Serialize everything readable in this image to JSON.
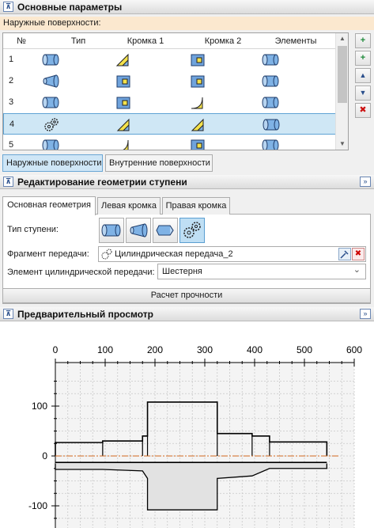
{
  "main_section": {
    "title": "Основные параметры",
    "collapse_glyph": "⊼",
    "subheader": "Наружные поверхности:"
  },
  "grid": {
    "columns": [
      "№",
      "Тип",
      "Кромка 1",
      "Кромка 2",
      "Элементы"
    ],
    "rows": [
      {
        "num": "1",
        "type": "cylinder-icon",
        "edge1": "chamfer-icon",
        "edge2": "groove-icon",
        "elements": "cylinder-icon"
      },
      {
        "num": "2",
        "type": "cone-icon",
        "edge1": "groove-icon",
        "edge2": "groove-icon",
        "elements": "cylinder-icon"
      },
      {
        "num": "3",
        "type": "cylinder-icon",
        "edge1": "groove-icon",
        "edge2": "fillet-icon",
        "elements": "cylinder-icon"
      },
      {
        "num": "4",
        "type": "gear-icon",
        "edge1": "chamfer-icon",
        "edge2": "chamfer-icon",
        "elements": "cylinder-icon",
        "selected": true
      },
      {
        "num": "5",
        "type": "cylinder-icon",
        "edge1": "fillet-icon",
        "edge2": "groove-icon",
        "elements": "cylinder-icon"
      }
    ]
  },
  "side_buttons": [
    {
      "name": "add-surface-button",
      "icon": "add-icon",
      "glyph": "+"
    },
    {
      "name": "insert-surface-button",
      "icon": "insert-icon",
      "glyph": "+"
    },
    {
      "name": "move-up-button",
      "icon": "chevron-up-icon",
      "glyph": "▲"
    },
    {
      "name": "move-down-button",
      "icon": "chevron-down-icon",
      "glyph": "▼"
    },
    {
      "name": "delete-button",
      "icon": "delete-icon",
      "glyph": "✖"
    }
  ],
  "surface_tabs": {
    "outer": "Наружные поверхности",
    "inner": "Внутренние поверхности"
  },
  "edit_section": {
    "title": "Редактирование геометрии ступени",
    "expand_glyph": "»"
  },
  "geometry_tabs": {
    "main": "Основная геометрия",
    "left": "Левая кромка",
    "right": "Правая кромка"
  },
  "form": {
    "step_type_label": "Тип ступени:",
    "gear_fragment_label": "Фрагмент передачи:",
    "gear_fragment_value": "Цилиндрическая передача_2",
    "gear_element_label": "Элемент цилиндрической передачи:",
    "gear_element_value": "Шестерня",
    "dropdown_glyph": "⌄",
    "strength_button": "Расчет прочности"
  },
  "preview_section": {
    "title": "Предварительный просмотр"
  },
  "chart_data": {
    "type": "line",
    "x_ticks": [
      "0",
      "100",
      "200",
      "300",
      "400",
      "500",
      "600"
    ],
    "y_ticks": [
      "100",
      "0",
      "-100"
    ],
    "xlim": [
      0,
      600
    ],
    "grid": true,
    "profile_top": [
      [
        0,
        0
      ],
      [
        0,
        27
      ],
      [
        95,
        27
      ],
      [
        95,
        30
      ],
      [
        175,
        30
      ],
      [
        175,
        40
      ],
      [
        185,
        40
      ],
      [
        185,
        108
      ],
      [
        325,
        108
      ],
      [
        325,
        45
      ],
      [
        395,
        45
      ],
      [
        395,
        40
      ],
      [
        430,
        40
      ],
      [
        430,
        28
      ],
      [
        545,
        28
      ],
      [
        545,
        0
      ]
    ],
    "profile_bottom": [
      [
        0,
        -15
      ],
      [
        0,
        -27
      ],
      [
        95,
        -27
      ],
      [
        175,
        -30
      ],
      [
        185,
        -45
      ],
      [
        185,
        -108
      ],
      [
        325,
        -108
      ],
      [
        325,
        -45
      ],
      [
        395,
        -40
      ],
      [
        430,
        -25
      ],
      [
        545,
        -25
      ],
      [
        545,
        -15
      ]
    ],
    "bore": [
      [
        0,
        -13
      ],
      [
        545,
        -13
      ]
    ],
    "axis_line": [
      [
        0,
        0
      ],
      [
        570,
        0
      ]
    ]
  }
}
